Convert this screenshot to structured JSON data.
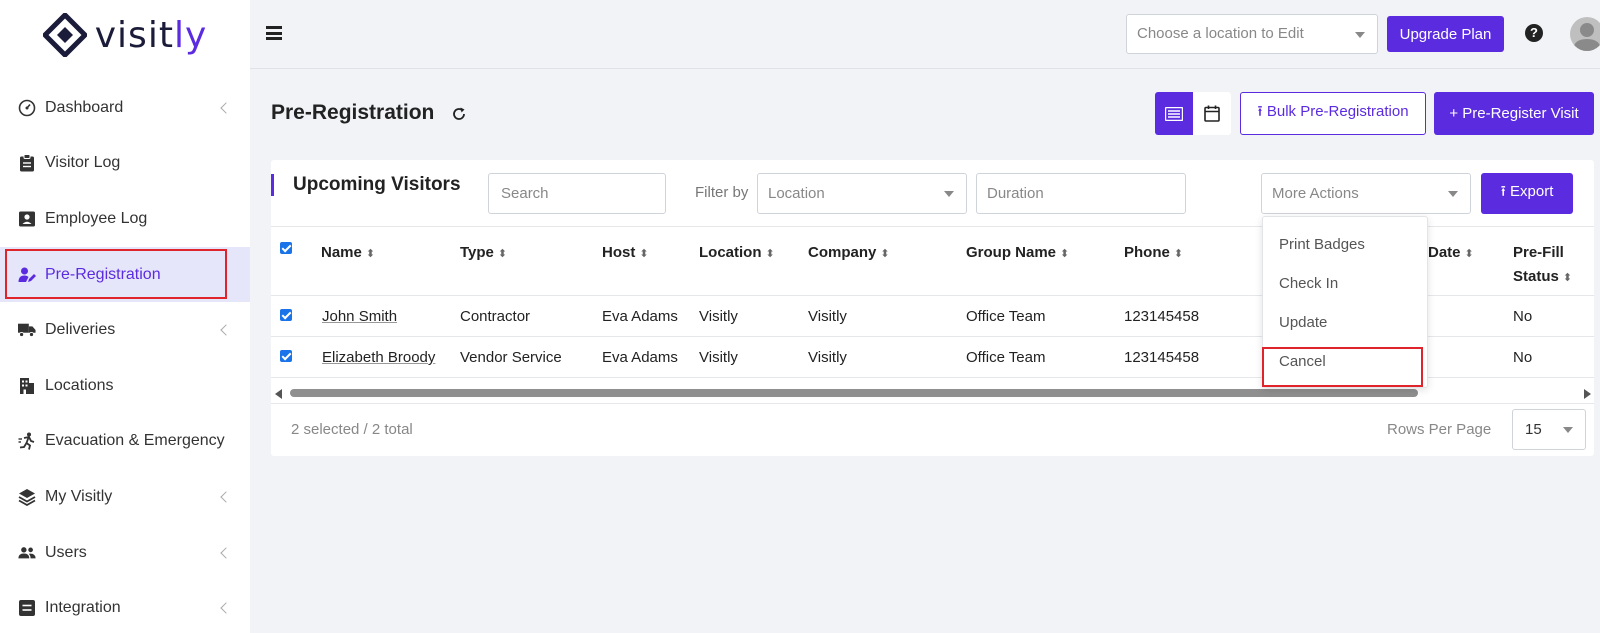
{
  "brand": {
    "name_main": "visit",
    "name_accent": "ly"
  },
  "sidebar": {
    "items": [
      {
        "label": "Dashboard",
        "icon": "gauge-icon",
        "has_children": true
      },
      {
        "label": "Visitor Log",
        "icon": "clipboard-icon",
        "has_children": false
      },
      {
        "label": "Employee Log",
        "icon": "id-card-icon",
        "has_children": false
      },
      {
        "label": "Pre-Registration",
        "icon": "user-edit-icon",
        "has_children": false,
        "active": true
      },
      {
        "label": "Deliveries",
        "icon": "truck-icon",
        "has_children": true
      },
      {
        "label": "Locations",
        "icon": "building-icon",
        "has_children": false
      },
      {
        "label": "Evacuation & Emergency",
        "icon": "running-person-icon",
        "has_children": false
      },
      {
        "label": "My Visitly",
        "icon": "layers-icon",
        "has_children": true
      },
      {
        "label": "Users",
        "icon": "users-icon",
        "has_children": true
      },
      {
        "label": "Integration",
        "icon": "list-box-icon",
        "has_children": true
      }
    ]
  },
  "topbar": {
    "location_placeholder": "Choose a location to Edit",
    "upgrade_label": "Upgrade Plan",
    "help_glyph": "?"
  },
  "page": {
    "title": "Pre-Registration",
    "bulk_label": "Bulk Pre-Registration",
    "prereg_label": "Pre-Register Visit",
    "bulk_prefix": "⭱",
    "prereg_prefix": "+"
  },
  "card": {
    "title": "Upcoming Visitors",
    "search_placeholder": "Search",
    "filter_label": "Filter by",
    "location_placeholder": "Location",
    "duration_placeholder": "Duration",
    "more_actions_label": "More Actions",
    "export_label": "Export",
    "export_prefix": "⭱"
  },
  "table": {
    "columns": [
      "Name",
      "Type",
      "Host",
      "Location",
      "Company",
      "Group Name",
      "Phone",
      "Date",
      "Pre-Fill",
      "Status"
    ],
    "rows": [
      {
        "name": "John Smith",
        "type": "Contractor",
        "host": "Eva Adams",
        "location": "Visitly",
        "company": "Visitly",
        "group": "Office Team",
        "phone": "123145458",
        "prefill": "No"
      },
      {
        "name": "Elizabeth Broody",
        "type": "Vendor Service",
        "host": "Eva Adams",
        "location": "Visitly",
        "company": "Visitly",
        "group": "Office Team",
        "phone": "123145458",
        "prefill": "No"
      }
    ]
  },
  "more_actions_menu": [
    "Print Badges",
    "Check In",
    "Update",
    "Cancel"
  ],
  "footer": {
    "selection_text": "2 selected / 2 total",
    "rows_per_page_label": "Rows Per Page",
    "rows_per_page_value": "15"
  },
  "colors": {
    "accent": "#5b2be0",
    "highlight": "#e0242c",
    "active_bg": "#e6e6fb"
  }
}
